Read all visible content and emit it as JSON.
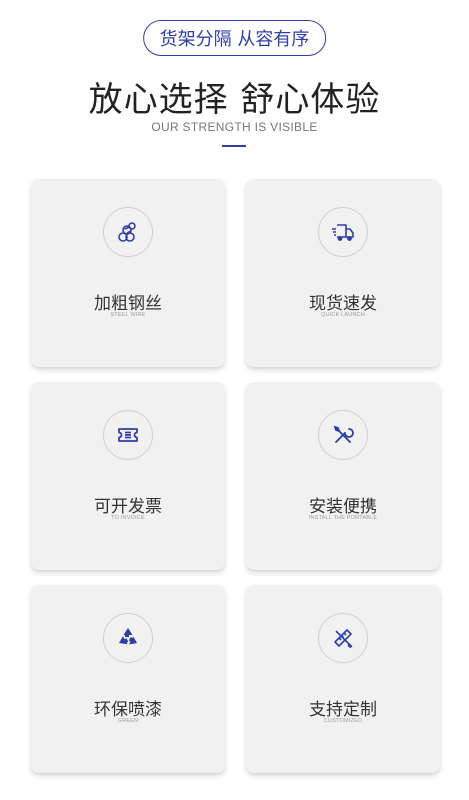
{
  "header": {
    "pill_text": "货架分隔 从容有序",
    "headline": "放心选择 舒心体验",
    "subtitle": "OUR STRENGTH IS VISIBLE"
  },
  "colors": {
    "accent": "#2f3fa8",
    "card_bg": "#f1f1f1",
    "title_text": "#333333"
  },
  "features": [
    {
      "title": "加粗钢丝",
      "subtitle": "STEEL WIRE",
      "icon": "steel-wire-icon"
    },
    {
      "title": "现货速发",
      "subtitle": "QUICK LAUNCH",
      "icon": "delivery-truck-icon"
    },
    {
      "title": "可开发票",
      "subtitle": "TO INVOICE",
      "icon": "invoice-ticket-icon"
    },
    {
      "title": "安装便携",
      "subtitle": "INSTALL THE PORTABLE",
      "icon": "tools-icon"
    },
    {
      "title": "环保喷漆",
      "subtitle": "GREEN",
      "icon": "recycle-icon"
    },
    {
      "title": "支持定制",
      "subtitle": "CUSTOMIZED",
      "icon": "ruler-pencil-icon"
    }
  ]
}
